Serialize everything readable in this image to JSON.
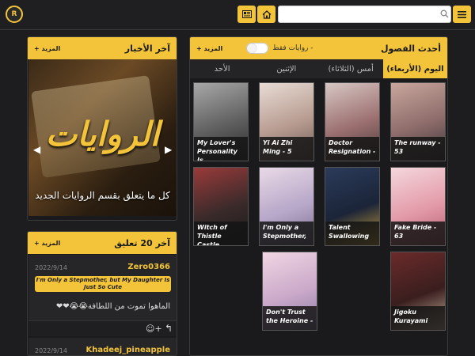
{
  "header": {
    "logo_text": "R",
    "search_placeholder": ""
  },
  "chapters_panel": {
    "title": "أحدث الفصول",
    "toggle_label": "- روايات فقط",
    "more": "+ المزيد",
    "tabs": [
      {
        "label": "اليوم (الأربعاء)",
        "active": true
      },
      {
        "label": "أمس (الثلاثاء)",
        "active": false
      },
      {
        "label": "الإثنين",
        "active": false
      },
      {
        "label": "الأحد",
        "active": false
      }
    ],
    "cards": [
      {
        "title": "The runway - 53",
        "colors": [
          "#c9a79d",
          "#8c6b6a",
          "#3d3538"
        ]
      },
      {
        "title": "Doctor Resignation -",
        "colors": [
          "#d7c7c4",
          "#9b6f6f",
          "#4a3a3a"
        ]
      },
      {
        "title": "Yi Ai Zhi Ming - 5",
        "colors": [
          "#e8dcd5",
          "#b79b90",
          "#6c5a55"
        ]
      },
      {
        "title": "My Lover's Personality Is",
        "colors": [
          "#a8a8a8",
          "#5f5f5f",
          "#2c2c2c"
        ]
      },
      {
        "title": "Fake Bride - 63",
        "colors": [
          "#f4d7dd",
          "#e39aa8",
          "#b45c6f"
        ]
      },
      {
        "title": "Talent Swallowing",
        "colors": [
          "#2a3b5a",
          "#1b2438",
          "#d5a73a"
        ]
      },
      {
        "title": "I'm Only a Stepmother,",
        "colors": [
          "#e9d9e6",
          "#b7a7c9",
          "#7a6a8c"
        ]
      },
      {
        "title": "Witch of Thistle Castle",
        "colors": [
          "#9a3a3a",
          "#3a2a2a",
          "#1a1a1a"
        ]
      },
      {
        "title": "Jigoku Kurayami",
        "colors": [
          "#6b2a2a",
          "#3a1e1e",
          "#c9b6a0"
        ]
      },
      {
        "title": "Don't Trust the Heroine -",
        "colors": [
          "#f1d6e3",
          "#c9a8c9",
          "#8c7aa6"
        ]
      }
    ]
  },
  "news_panel": {
    "title": "آخر الأخبار",
    "more": "+ المزيد",
    "image_title": "الروايات",
    "caption": "كل ما يتعلق بقسم الروايات الجديد"
  },
  "comments_panel": {
    "title": "آخر 20 تعليق",
    "more": "+ المزيد",
    "comments": [
      {
        "user": "Zero0366",
        "date": "2022/9/14",
        "series": "I'm Only a Stepmother, but My Daughter Is Just So Cute",
        "text": "الماهوا تموت من اللطافة😭😭❤❤"
      },
      {
        "user": "Khadeej_pineapple",
        "date": "2022/9/14"
      }
    ],
    "actions": {
      "reply_icon": "↰",
      "react_icon": "☺+"
    }
  }
}
